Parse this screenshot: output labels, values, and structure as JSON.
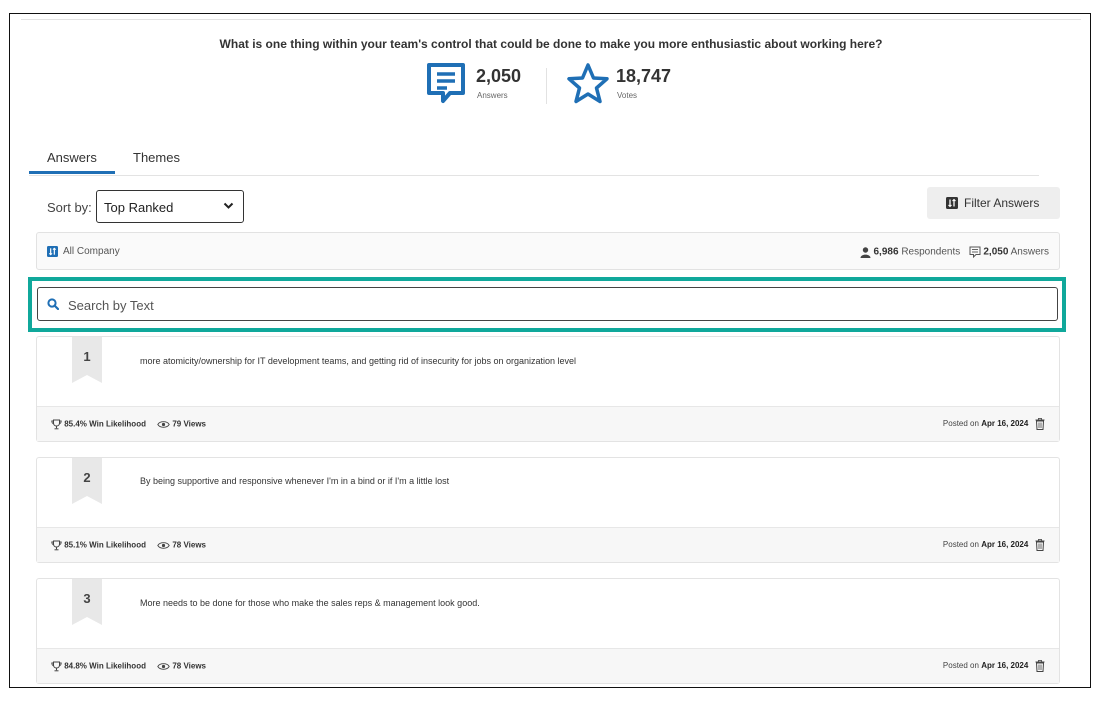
{
  "header": {
    "question": "What is one thing within your team's control that could be done to make you more enthusiastic about working here?"
  },
  "stats": {
    "answers": {
      "value": "2,050",
      "label": "Answers",
      "icon": "speech-bubble-icon"
    },
    "votes": {
      "value": "18,747",
      "label": "Votes",
      "icon": "star-icon"
    }
  },
  "tabs": [
    {
      "label": "Answers",
      "active": true
    },
    {
      "label": "Themes",
      "active": false
    }
  ],
  "sort": {
    "label": "Sort by:",
    "selected": "Top Ranked"
  },
  "filter_button": {
    "label": "Filter Answers"
  },
  "scope": {
    "name": "All Company",
    "respondents": "6,986",
    "respondents_label": "Respondents",
    "answers": "2,050",
    "answers_label": "Answers"
  },
  "search": {
    "placeholder": "Search by Text"
  },
  "answers": [
    {
      "rank": "1",
      "text": "more atomicity/ownership for IT development teams, and getting rid of insecurity for jobs on organization level",
      "win_likelihood": "85.4%",
      "win_label": "Win Likelihood",
      "views": "79",
      "views_label": "Views",
      "posted_label": "Posted on",
      "posted_date": "Apr 16, 2024"
    },
    {
      "rank": "2",
      "text": "By being supportive and responsive whenever I'm in a bind or if I'm a little lost",
      "win_likelihood": "85.1%",
      "win_label": "Win Likelihood",
      "views": "78",
      "views_label": "Views",
      "posted_label": "Posted on",
      "posted_date": "Apr 16, 2024"
    },
    {
      "rank": "3",
      "text": "More needs to be done for those who make the sales reps & management look good.",
      "win_likelihood": "84.8%",
      "win_label": "Win Likelihood",
      "views": "78",
      "views_label": "Views",
      "posted_label": "Posted on",
      "posted_date": "Apr 16, 2024"
    }
  ],
  "colors": {
    "accent_blue": "#1f6fb5",
    "highlight_teal": "#10a89b"
  }
}
